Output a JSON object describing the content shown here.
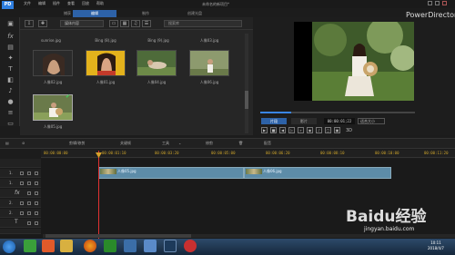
{
  "app": {
    "logo_text": "PD",
    "title": "未命名的新项目*",
    "brand": "PowerDirector",
    "menu": [
      "文件",
      "编辑",
      "插件",
      "查看",
      "回放",
      "帮助"
    ]
  },
  "mode_tabs": [
    "捕获",
    "编辑",
    "制作",
    "创建光盘"
  ],
  "library": {
    "filter": "媒体内容",
    "search_placeholder": "搜索库",
    "top_row_labels": [
      "sunrise.jpg",
      "Bing (8).jpg",
      "Bing (9).jpg",
      "人像03.jpg"
    ],
    "items": [
      {
        "label": "人像02.jpg",
        "selected": false
      },
      {
        "label": "人像01.jpg",
        "selected": false
      },
      {
        "label": "人像04.jpg",
        "selected": false
      },
      {
        "label": "人像06.jpg",
        "selected": false
      },
      {
        "label": "人像05.jpg",
        "selected": true
      }
    ]
  },
  "preview": {
    "clip_label": "片段",
    "movie_label": "影片",
    "timecode": "00:00:01;22",
    "size_label": "适合大小",
    "mode_3d": "3D"
  },
  "timeline_toolbar": {
    "items": [
      "剪辑/修剪",
      "关键帧",
      "工具",
      "修剪",
      "配音"
    ]
  },
  "ruler": {
    "labels": [
      "00:00:00:00",
      "00:00:01:10",
      "00:00:03:20",
      "00:00:05:00",
      "00:00:06:20",
      "00:00:08:10",
      "00:00:10:00",
      "00:00:11:20"
    ]
  },
  "tracks": {
    "rows": [
      {
        "num": "",
        "kind": "header"
      },
      {
        "num": "1.",
        "kind": "video"
      },
      {
        "num": "1.",
        "kind": "audio"
      },
      {
        "num": "",
        "kind": "fx"
      },
      {
        "num": "2.",
        "kind": "video"
      },
      {
        "num": "2.",
        "kind": "audio"
      },
      {
        "num": "",
        "kind": "title"
      },
      {
        "num": "",
        "kind": "voice"
      }
    ],
    "clips": [
      {
        "label": "人像05.jpg"
      },
      {
        "label": "人像06.jpg"
      }
    ]
  },
  "taskbar": {
    "time": "10:11",
    "date": "2018/4/7"
  },
  "watermark": {
    "text": "Baidu经验",
    "url": "jingyan.baidu.com"
  },
  "colors": {
    "accent": "#2d62a8",
    "playhead": "#e23232",
    "clip": "#5d8ca8"
  }
}
